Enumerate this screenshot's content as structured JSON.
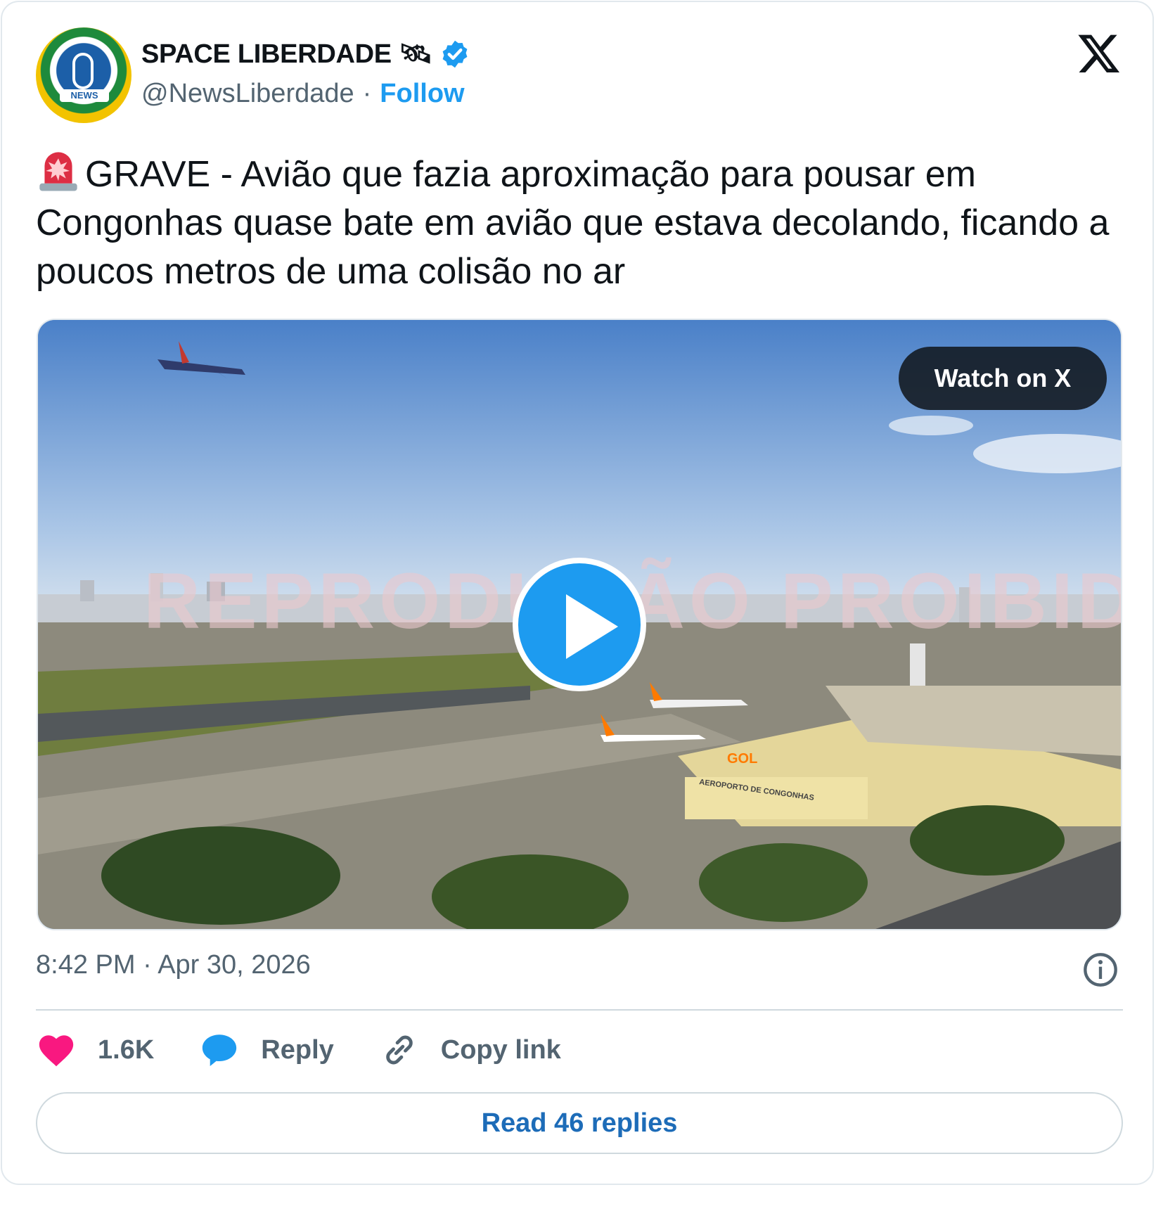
{
  "author": {
    "name": "SPACE LIBERDADE 🛰",
    "handle": "@NewsLiberdade",
    "separator": "·",
    "follow_label": "Follow",
    "avatar_text": "NEWS"
  },
  "tweet": {
    "text": "GRAVE - Avião que fazia aproximação para pousar em Congonhas quase bate em avião que estava decolando, ficando a poucos metros de uma colisão no ar",
    "emoji": "rotating-light-icon"
  },
  "media": {
    "watch_label": "Watch on X",
    "watermark": "REPRODUÇÃO PROIBIDA",
    "airport_sign": "AEROPORTO DE CONGONHAS",
    "airline_text": "GOL"
  },
  "meta": {
    "timestamp": "8:42 PM · Apr 30, 2026"
  },
  "actions": {
    "likes": "1.6K",
    "reply_label": "Reply",
    "copy_label": "Copy link"
  },
  "footer": {
    "read_replies": "Read 46 replies"
  },
  "colors": {
    "accent": "#1d9bf0",
    "like": "#f91880",
    "muted": "#536471"
  }
}
